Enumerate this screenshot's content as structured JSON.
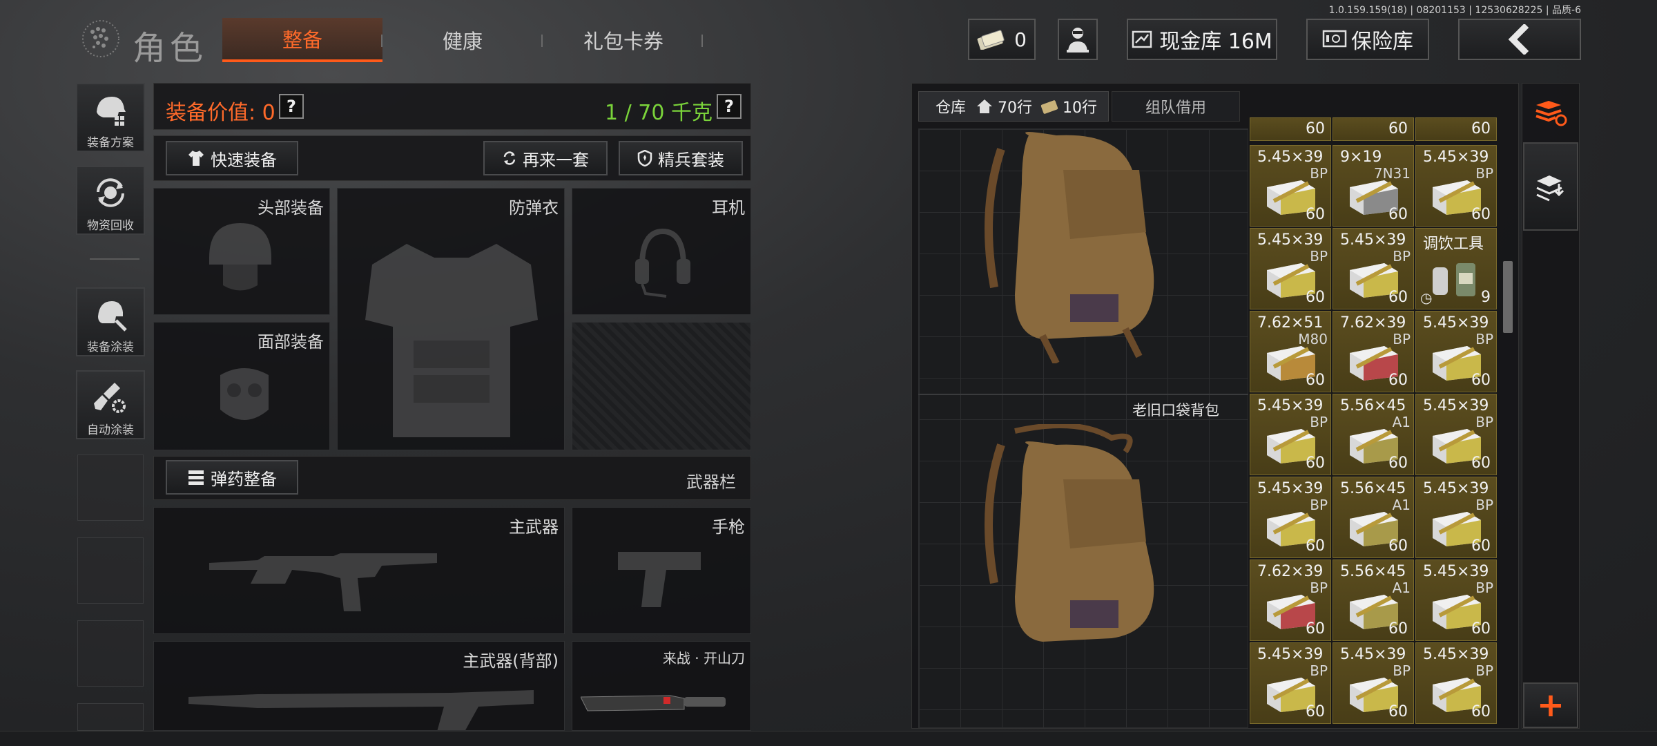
{
  "version_text": "1.0.159.159(18) | 08201153 | 12530628225 | 品质-6",
  "header": {
    "title": "角色",
    "tabs": [
      {
        "label": "整备",
        "active": true
      },
      {
        "label": "健康",
        "active": false
      },
      {
        "label": "礼包卡券",
        "active": false
      }
    ],
    "money_count": "0",
    "cash_label": "现金库 16M",
    "safe_label": "保险库"
  },
  "sidebar": {
    "items": [
      {
        "label": "装备方案",
        "icon": "loadout-icon"
      },
      {
        "label": "物资回收",
        "icon": "recycle-icon"
      },
      {
        "label": "装备涂装",
        "icon": "paint-helmet-icon"
      },
      {
        "label": "自动涂装",
        "icon": "auto-paint-icon"
      }
    ]
  },
  "equipment": {
    "value_label": "装备价值: 0",
    "weight_label": "1 / 70 千克",
    "quick_equip": "快速装备",
    "again_set": "再来一套",
    "elite_set": "精兵套装",
    "slots": {
      "head": "头部装备",
      "armor": "防弹衣",
      "headset": "耳机",
      "face": "面部装备",
      "ammo_btn": "弹药整备",
      "weapon_bar": "武器栏",
      "primary": "主武器",
      "pistol": "手枪",
      "primary_back": "主武器(背部)",
      "melee": "来战 · 开山刀"
    }
  },
  "warehouse": {
    "tab_label": "仓库",
    "rows_home": "70行",
    "rows_ticket": "10行",
    "team_tab": "组队借用",
    "bag_name": "老旧口袋背包",
    "top_partial_counts": [
      "60",
      "60",
      "60"
    ],
    "items": [
      {
        "cal": "5.45×39",
        "type": "BP",
        "count": "60",
        "color": "#c9b84a"
      },
      {
        "cal": "9×19",
        "type": "7N31",
        "count": "60",
        "color": "#8a8a8a"
      },
      {
        "cal": "5.45×39",
        "type": "BP",
        "count": "60",
        "color": "#c9b84a"
      },
      {
        "cal": "5.45×39",
        "type": "BP",
        "count": "60",
        "color": "#c9b84a"
      },
      {
        "cal": "5.45×39",
        "type": "BP",
        "count": "60",
        "color": "#c9b84a"
      },
      {
        "cal": "调饮工具",
        "type": "",
        "count": "9",
        "color": "#6a7a5a"
      },
      {
        "cal": "7.62×51",
        "type": "M80",
        "count": "60",
        "color": "#b88a3a"
      },
      {
        "cal": "7.62×39",
        "type": "BP",
        "count": "60",
        "color": "#b8474a"
      },
      {
        "cal": "5.45×39",
        "type": "BP",
        "count": "60",
        "color": "#c9b84a"
      },
      {
        "cal": "5.45×39",
        "type": "BP",
        "count": "60",
        "color": "#c9b84a"
      },
      {
        "cal": "5.56×45",
        "type": "A1",
        "count": "60",
        "color": "#a89a4a"
      },
      {
        "cal": "5.45×39",
        "type": "BP",
        "count": "60",
        "color": "#c9b84a"
      },
      {
        "cal": "5.45×39",
        "type": "BP",
        "count": "60",
        "color": "#c9b84a"
      },
      {
        "cal": "5.56×45",
        "type": "A1",
        "count": "60",
        "color": "#a89a4a"
      },
      {
        "cal": "5.45×39",
        "type": "BP",
        "count": "60",
        "color": "#c9b84a"
      },
      {
        "cal": "7.62×39",
        "type": "BP",
        "count": "60",
        "color": "#b8474a"
      },
      {
        "cal": "5.56×45",
        "type": "A1",
        "count": "60",
        "color": "#a89a4a"
      },
      {
        "cal": "5.45×39",
        "type": "BP",
        "count": "60",
        "color": "#c9b84a"
      },
      {
        "cal": "5.45×39",
        "type": "BP",
        "count": "60",
        "color": "#c9b84a"
      },
      {
        "cal": "5.45×39",
        "type": "BP",
        "count": "60",
        "color": "#c9b84a"
      },
      {
        "cal": "5.45×39",
        "type": "BP",
        "count": "60",
        "color": "#c9b84a"
      }
    ]
  },
  "right_column": {
    "buttons": [
      "sort-icon",
      "store-icon",
      "add-icon"
    ],
    "add_label": "+"
  },
  "colors": {
    "accent_orange": "#ff6a2a",
    "weight_green": "#7ad33a",
    "item_bg": "#524620"
  }
}
